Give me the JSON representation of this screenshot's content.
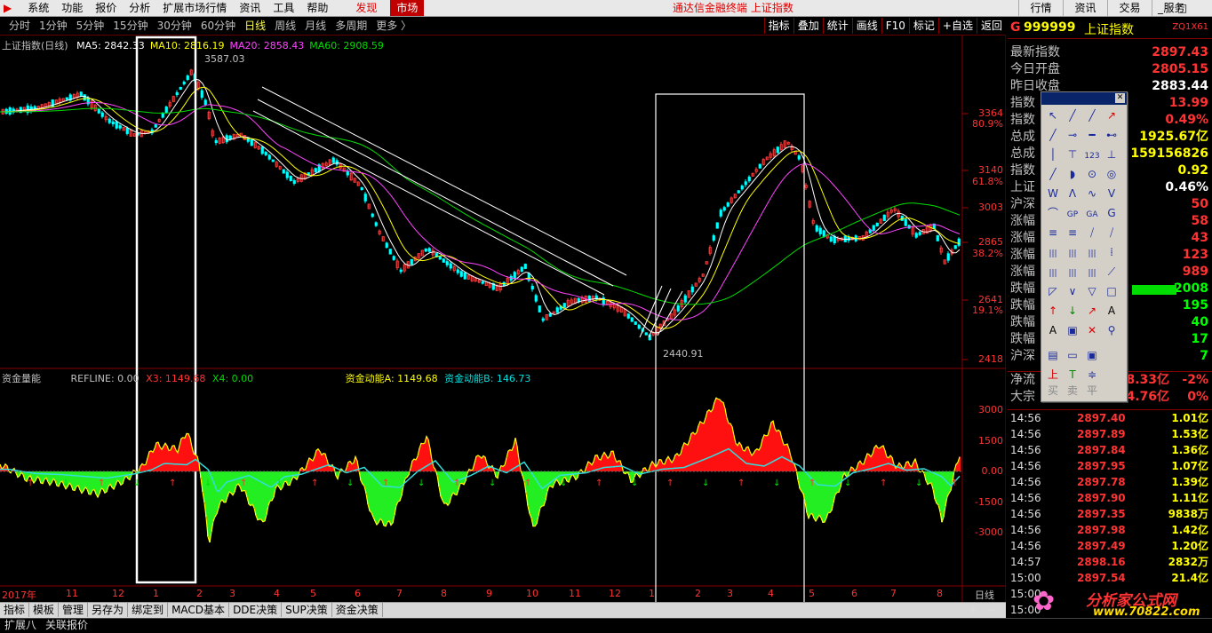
{
  "menubar": {
    "items": [
      "系统",
      "功能",
      "报价",
      "分析",
      "扩展市场行情",
      "资讯",
      "工具",
      "帮助"
    ],
    "discover": "发现",
    "market": "市场",
    "title": "通达信金融终端  上证指数",
    "right": [
      "行情",
      "资讯",
      "交易",
      "服务"
    ]
  },
  "periods": [
    "分时",
    "1分钟",
    "5分钟",
    "15分钟",
    "30分钟",
    "60分钟",
    "日线",
    "周线",
    "月线",
    "多周期",
    "更多 〉"
  ],
  "active_period": "日线",
  "right_tools": [
    "指标",
    "叠加",
    "统计",
    "画线",
    "F10",
    "标记",
    "+自选",
    "返回"
  ],
  "chart": {
    "title": "上证指数(日线)",
    "ma": [
      {
        "label": "MA5: 2842.33",
        "color": "#ffffff"
      },
      {
        "label": "MA10: 2816.19",
        "color": "#ffff00"
      },
      {
        "label": "MA20: 2858.43",
        "color": "#ff44ff"
      },
      {
        "label": "MA60: 2908.59",
        "color": "#00dd00"
      }
    ],
    "high_label": "3587.03",
    "low_label": "2440.91",
    "price_axis": [
      "3364",
      "3140",
      "3003",
      "2865",
      "2641",
      "2418"
    ],
    "pct_axis": [
      "80.9%",
      "61.8%",
      "38.2%",
      "19.1%"
    ],
    "indicator_name": "资金量能",
    "refline": "REFLINE: 0.00",
    "x3": "X3: 1149.68",
    "x4": "X4: 0.00",
    "flow_a": "资金动能A: 1149.68",
    "flow_b": "资金动能B: 146.73",
    "ind_axis": [
      "3000",
      "1500",
      "0.00",
      "-1500",
      "-3000"
    ],
    "months": [
      "2017年",
      "11",
      "12",
      "1",
      "2",
      "3",
      "4",
      "5",
      "6",
      "7",
      "8",
      "9",
      "10",
      "11",
      "12",
      "1",
      "2",
      "3",
      "4",
      "5",
      "6",
      "7",
      "8"
    ],
    "date_unit": "日线"
  },
  "right_panel": {
    "code": "999999",
    "name": "上证指数",
    "badge": "ZQ1X61",
    "rows": [
      {
        "k": "最新指数",
        "v": "2897.43",
        "c": "#ff3333"
      },
      {
        "k": "今日开盘",
        "v": "2805.15",
        "c": "#ff3333"
      },
      {
        "k": "昨日收盘",
        "v": "2883.44",
        "c": "#ffffff"
      },
      {
        "k": "指数",
        "v": "13.99",
        "c": "#ff3333"
      },
      {
        "k": "指数",
        "v": "0.49%",
        "c": "#ff3333"
      },
      {
        "k": "总成",
        "v": "1925.67亿",
        "c": "#ffff00"
      },
      {
        "k": "总成",
        "v": "159156826",
        "c": "#ffff00"
      },
      {
        "k": "指数",
        "v": "0.92",
        "c": "#ffff00"
      },
      {
        "k": "上证",
        "v": "0.46%",
        "c": "#ffffff"
      },
      {
        "k": "沪深",
        "v": "50",
        "c": "#ff3333"
      },
      {
        "k": "涨幅",
        "v": "58",
        "c": "#ff3333"
      },
      {
        "k": "涨幅",
        "v": "43",
        "c": "#ff3333"
      },
      {
        "k": "涨幅",
        "v": "123",
        "c": "#ff3333"
      },
      {
        "k": "涨幅",
        "v": "989",
        "c": "#ff3333"
      },
      {
        "k": "跌幅",
        "v": "2008",
        "c": "#00ff00"
      },
      {
        "k": "跌幅",
        "v": "195",
        "c": "#00ff00"
      },
      {
        "k": "跌幅",
        "v": "40",
        "c": "#00ff00"
      },
      {
        "k": "跌幅",
        "v": "17",
        "c": "#00ff00"
      },
      {
        "k": "沪深",
        "v": "7",
        "c": "#00ff00"
      }
    ],
    "netflow_k": "净流",
    "netflow_v": "38.33亿",
    "netflow_p": "-2%",
    "bigdeal_k": "大宗",
    "bigdeal_v": "4.76亿",
    "bigdeal_p": "0%",
    "ticks": [
      {
        "t": "14:56",
        "p": "2897.40",
        "v": "1.01亿"
      },
      {
        "t": "14:56",
        "p": "2897.89",
        "v": "1.53亿"
      },
      {
        "t": "14:56",
        "p": "2897.84",
        "v": "1.36亿"
      },
      {
        "t": "14:56",
        "p": "2897.95",
        "v": "1.07亿"
      },
      {
        "t": "14:56",
        "p": "2897.78",
        "v": "1.39亿"
      },
      {
        "t": "14:56",
        "p": "2897.90",
        "v": "1.11亿"
      },
      {
        "t": "14:56",
        "p": "2897.35",
        "v": "9838万"
      },
      {
        "t": "14:56",
        "p": "2897.98",
        "v": "1.42亿"
      },
      {
        "t": "14:56",
        "p": "2897.49",
        "v": "1.20亿"
      },
      {
        "t": "14:57",
        "p": "2898.16",
        "v": "2832万"
      },
      {
        "t": "15:00",
        "p": "2897.54",
        "v": "21.4亿"
      },
      {
        "t": "15:00",
        "p": "",
        "v": ""
      },
      {
        "t": "15:00",
        "p": "",
        "v": ""
      }
    ]
  },
  "toolbox": {
    "bottom": [
      "买",
      "卖",
      "平"
    ]
  },
  "bottom_tabs": [
    "指标",
    "模板",
    "管理",
    "另存为",
    "绑定到",
    "MACD基本",
    "DDE决策",
    "SUP决策",
    "资金决策"
  ],
  "status": [
    "扩展八",
    "关联报价"
  ],
  "watermark": {
    "name": "分析家公式网",
    "url": "www.70822.com"
  }
}
